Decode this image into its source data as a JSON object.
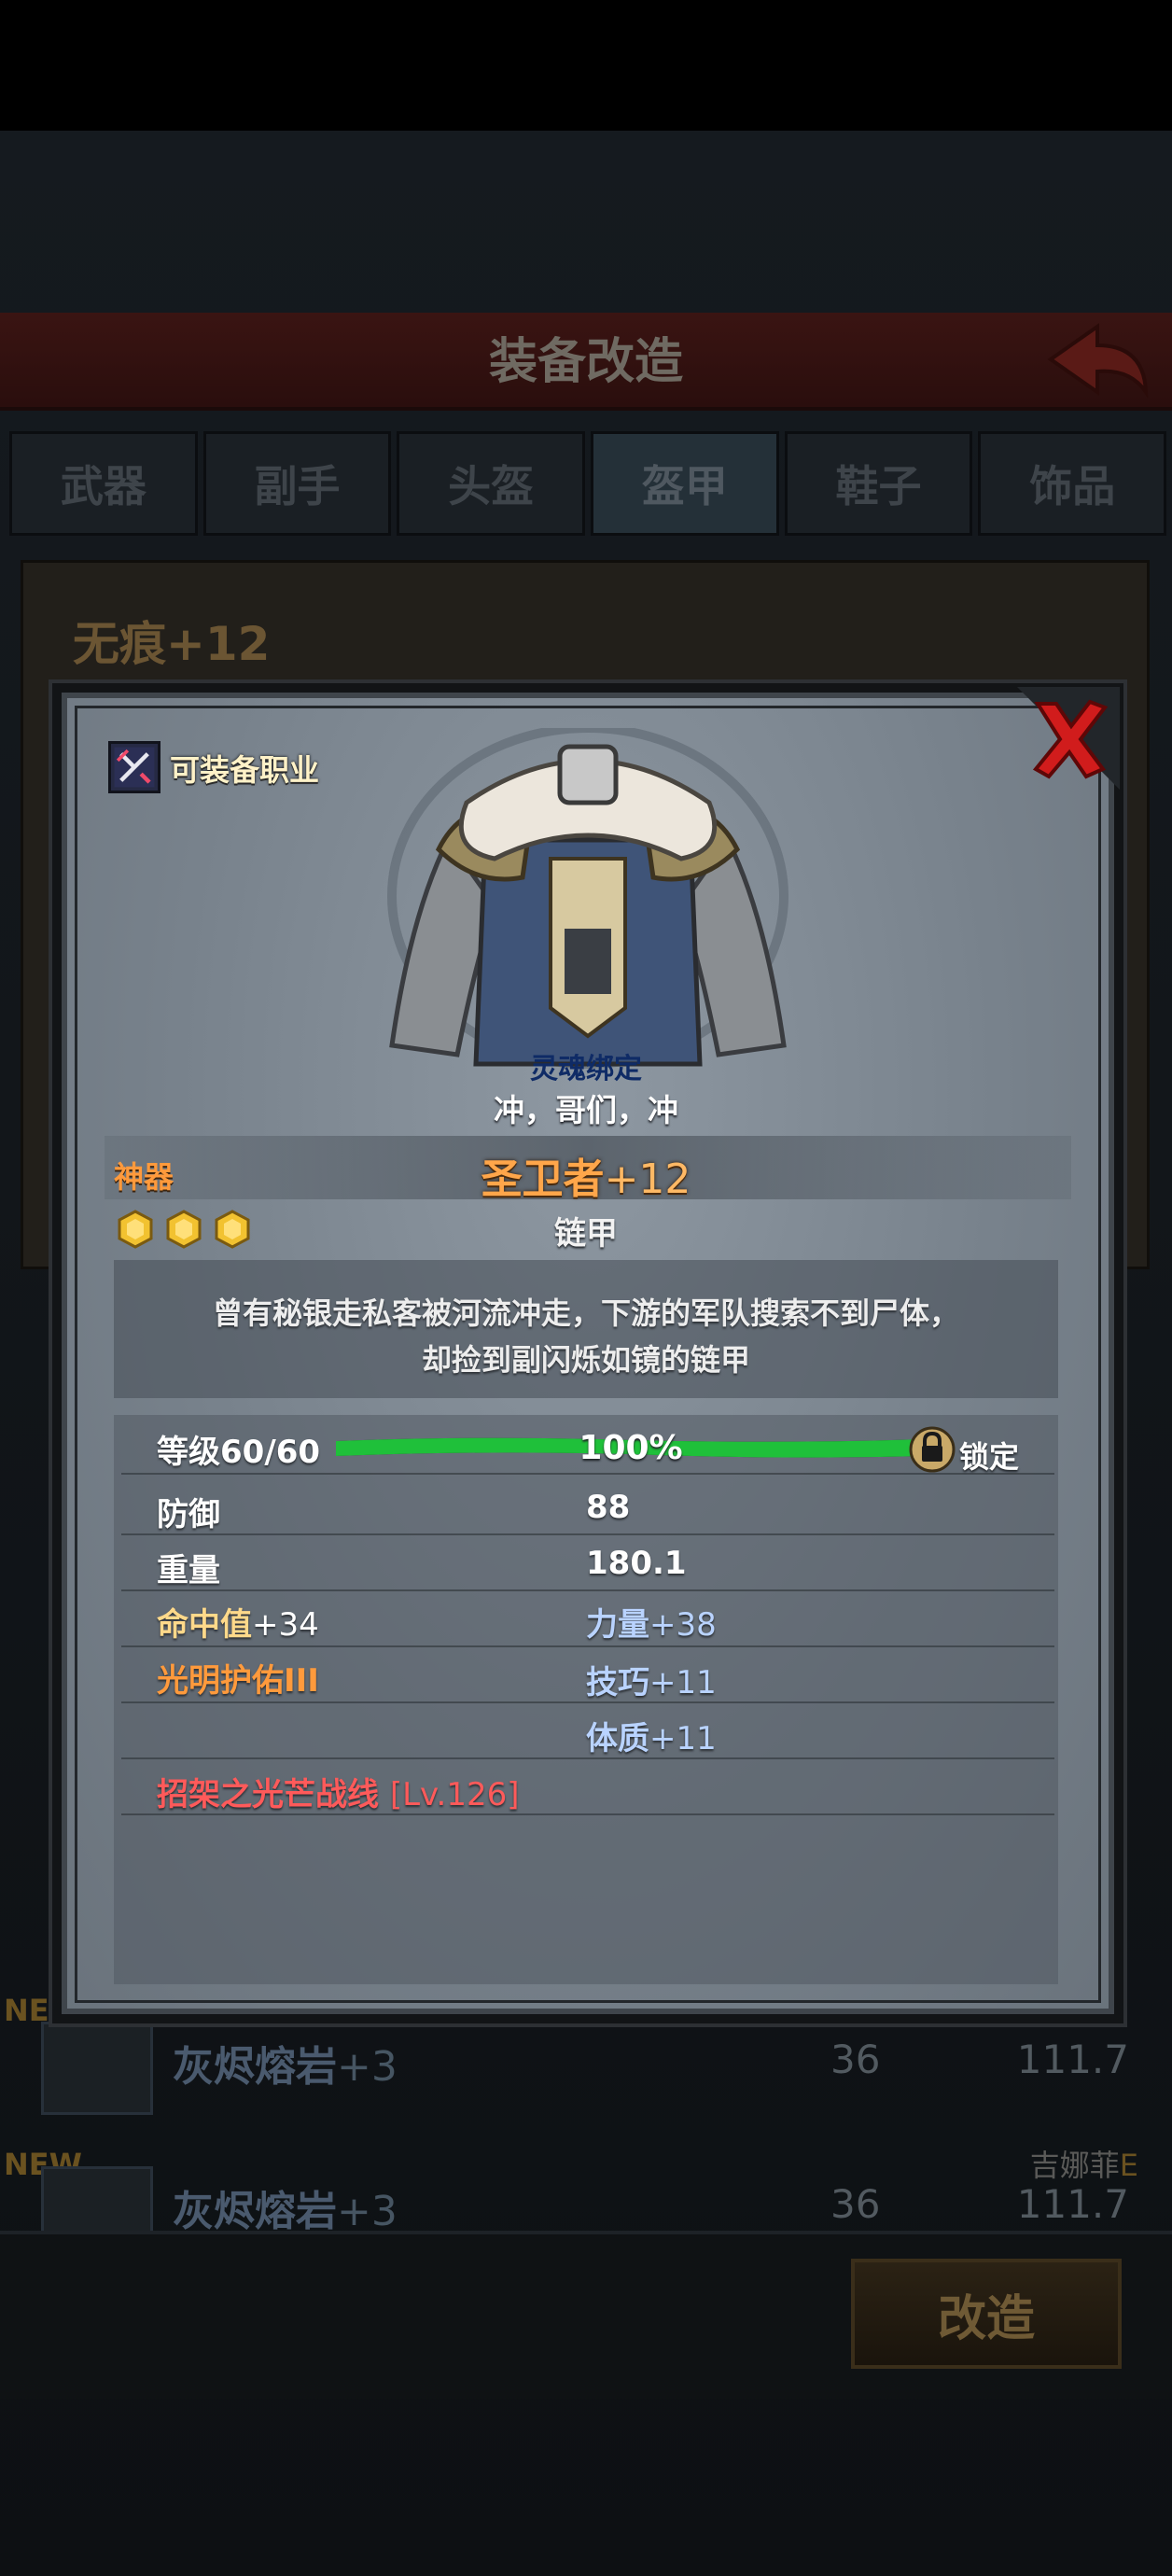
{
  "background": {
    "title": "装备改造",
    "tabs": [
      "武器",
      "副手",
      "头盔",
      "盔甲",
      "鞋子",
      "饰品"
    ],
    "active_tab": "盔甲",
    "selected_item": "无痕+12",
    "list": [
      {
        "new": "NEW",
        "name": "灰烬熔岩",
        "plus": "+3",
        "v1": "36",
        "v2": "111.7"
      },
      {
        "new": "NEW",
        "name": "灰烬熔岩",
        "plus": "+3",
        "v1": "36",
        "v2": "111.7"
      }
    ],
    "owner": "吉娜菲",
    "owner_suffix": "E",
    "modify_button": "改造"
  },
  "modal": {
    "job_label": "可装备职业",
    "soulbound": "灵魂绑定",
    "owner_line": "冲，哥们，冲",
    "rarity": "神器",
    "name": "圣卫者",
    "enhance": "+12",
    "stars": 3,
    "type": "链甲",
    "description_line1": "曾有秘银走私客被河流冲走，下游的军队搜索不到尸体，",
    "description_line2": "却捡到副闪烁如镜的链甲",
    "level_label": "等级60/60",
    "level_progress": 1.0,
    "level_pct": "100%",
    "lock_label": "锁定",
    "stats": {
      "defense_label": "防御",
      "defense_value": "88",
      "weight_label": "重量",
      "weight_value": "180.1",
      "hit": "命中值",
      "hit_value": "+34",
      "str": "力量",
      "str_value": "+38",
      "blessing": "光明护佑III",
      "dex": "技巧",
      "dex_value": "+11",
      "con": "体质",
      "con_value": "+11",
      "skill": "招架之光芒战线",
      "skill_level": "[Lv.126]"
    },
    "colors": {
      "rarity": "#ff9a3c",
      "bar_green": "#1fc03a",
      "skill_red": "#ff5a5a",
      "stat_blue": "#b9d3ff"
    }
  }
}
